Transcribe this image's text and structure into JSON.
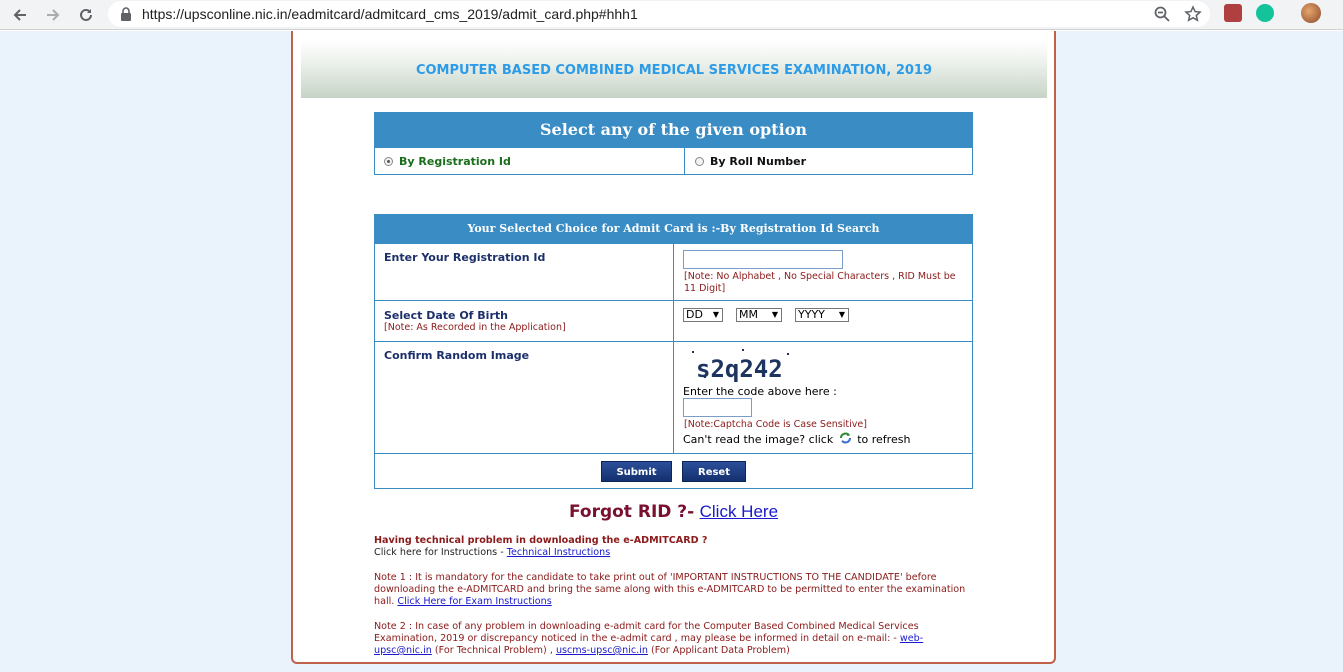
{
  "browser": {
    "url": "https://upsconline.nic.in/eadmitcard/admitcard_cms_2019/admit_card.php#hhh1"
  },
  "banner": {
    "title": "COMPUTER BASED COMBINED MEDICAL SERVICES EXAMINATION, 2019"
  },
  "options": {
    "heading": "Select any of the given option",
    "option_1": "By Registration Id",
    "option_2": "By Roll Number",
    "selected": "By Registration Id"
  },
  "form": {
    "heading": "Your Selected Choice for Admit Card is :-By Registration Id Search",
    "registration_label": "Enter Your Registration Id",
    "registration_note": "[Note: No Alphabet , No Special Characters , RID Must be 11 Digit]",
    "registration_value": "",
    "dob_label": "Select Date Of Birth",
    "dob_note": "[Note: As Recorded in the Application]",
    "dob_day": "DD",
    "dob_month": "MM",
    "dob_year": "YYYY",
    "captcha_label": "Confirm Random Image",
    "captcha_code": "s2q242",
    "captcha_prompt": "Enter the code above here :",
    "captcha_value": "",
    "captcha_note": "[Note:Captcha Code is Case Sensitive]",
    "refresh_prefix": "Can't read the image? click",
    "refresh_suffix": "to refresh",
    "submit_label": "Submit",
    "reset_label": "Reset"
  },
  "forgot": {
    "text": "Forgot RID ?-",
    "link": "Click Here"
  },
  "info": {
    "tech_heading": "Having technical problem in downloading the e-ADMITCARD ?",
    "tech_prefix": "Click here for Instructions -",
    "tech_link": "Technical Instructions",
    "note1": "Note 1 : It is mandatory for the candidate to take print out of 'IMPORTANT INSTRUCTIONS TO THE CANDIDATE' before downloading the e-ADMITCARD and bring the same along with this e-ADMITCARD to be permitted to enter the examination hall.",
    "note1_link": "Click Here for Exam Instructions",
    "note2": "Note 2 : In case of any problem in downloading e-admit card for the Computer Based Combined Medical Services Examination, 2019 or discrepancy noticed in the e-admit card , may please be informed in detail on e-mail: -",
    "email1": "web-upsc@nic.in",
    "email1_suffix": "(For Technical Problem) ,",
    "email2": "uscms-upsc@nic.in",
    "email2_suffix": "(For Applicant Data Problem)"
  },
  "colors": {
    "header_blue": "#3a8cc4",
    "banner_title": "#2e9be6",
    "note_red": "#8b1a1a",
    "button_navy": "#14306e",
    "frame_border": "#c0614a"
  },
  "icons": [
    "back-arrow-icon",
    "forward-arrow-icon",
    "reload-icon",
    "lock-icon",
    "zoom-icon",
    "star-icon",
    "pdf-extension-icon",
    "grammarly-extension-icon",
    "profile-avatar-icon",
    "refresh-captcha-icon"
  ]
}
